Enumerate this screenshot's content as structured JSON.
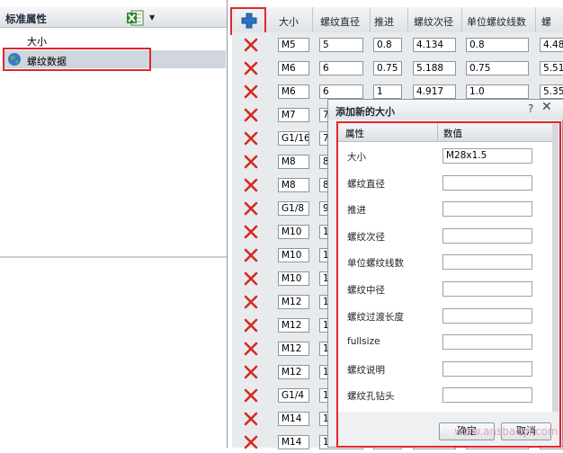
{
  "left_panel": {
    "title": "标准属性",
    "tree": [
      {
        "label": "大小",
        "icon": "none"
      },
      {
        "label": "螺纹数据",
        "icon": "globe-icon",
        "selected": true
      }
    ],
    "export_icon": "excel-icon",
    "dropdown_icon": "chevron-down-icon"
  },
  "grid": {
    "add_icon": "plus-icon",
    "columns": [
      "大小",
      "螺纹直径",
      "推进",
      "螺纹次径",
      "单位螺纹线数",
      "螺"
    ],
    "rows": [
      [
        "M5",
        "5",
        "0.8",
        "4.134",
        "0.8",
        "4.48"
      ],
      [
        "M6",
        "6",
        "0.75",
        "5.188",
        "0.75",
        "5.51"
      ],
      [
        "M6",
        "6",
        "1",
        "4.917",
        "1.0",
        "5.35"
      ],
      [
        "M7",
        "7",
        "",
        "",
        "",
        ""
      ],
      [
        "G1/16",
        "7",
        "",
        "",
        "",
        ""
      ],
      [
        "M8",
        "8",
        "",
        "",
        "",
        ""
      ],
      [
        "M8",
        "8",
        "",
        "",
        "",
        ""
      ],
      [
        "G1/8",
        "9",
        "",
        "",
        "",
        ""
      ],
      [
        "M10",
        "1",
        "",
        "",
        "",
        ""
      ],
      [
        "M10",
        "1",
        "",
        "",
        "",
        ""
      ],
      [
        "M10",
        "1",
        "",
        "",
        "",
        ""
      ],
      [
        "M12",
        "1",
        "",
        "",
        "",
        ""
      ],
      [
        "M12",
        "1",
        "",
        "",
        "",
        ""
      ],
      [
        "M12",
        "1",
        "",
        "",
        "",
        ""
      ],
      [
        "M12",
        "1",
        "",
        "",
        "",
        ""
      ],
      [
        "G1/4",
        "1",
        "",
        "",
        "",
        ""
      ],
      [
        "M14",
        "1",
        "",
        "",
        "",
        ""
      ],
      [
        "M14",
        "1",
        "",
        "",
        "",
        ""
      ]
    ],
    "delete_icon": "delete-x-icon"
  },
  "dialog": {
    "title": "添加新的大小",
    "help": "?",
    "close": "✕",
    "header_property": "属性",
    "header_value": "数值",
    "properties": [
      {
        "label": "大小",
        "value": "M28x1.5"
      },
      {
        "label": "螺纹直径",
        "value": ""
      },
      {
        "label": "推进",
        "value": ""
      },
      {
        "label": "螺纹次径",
        "value": ""
      },
      {
        "label": "单位螺纹线数",
        "value": ""
      },
      {
        "label": "螺纹中径",
        "value": ""
      },
      {
        "label": "螺纹过渡长度",
        "value": ""
      },
      {
        "label": "fullsize",
        "value": ""
      },
      {
        "label": "螺纹说明",
        "value": ""
      },
      {
        "label": "螺纹孔钻头",
        "value": ""
      }
    ],
    "ok_label": "确定",
    "cancel_label": "取消"
  },
  "watermark": "www.ansbaoyi.com",
  "colors": {
    "highlight": "#e3262e",
    "delete": "#d42a20",
    "add": "#2a72c2"
  }
}
